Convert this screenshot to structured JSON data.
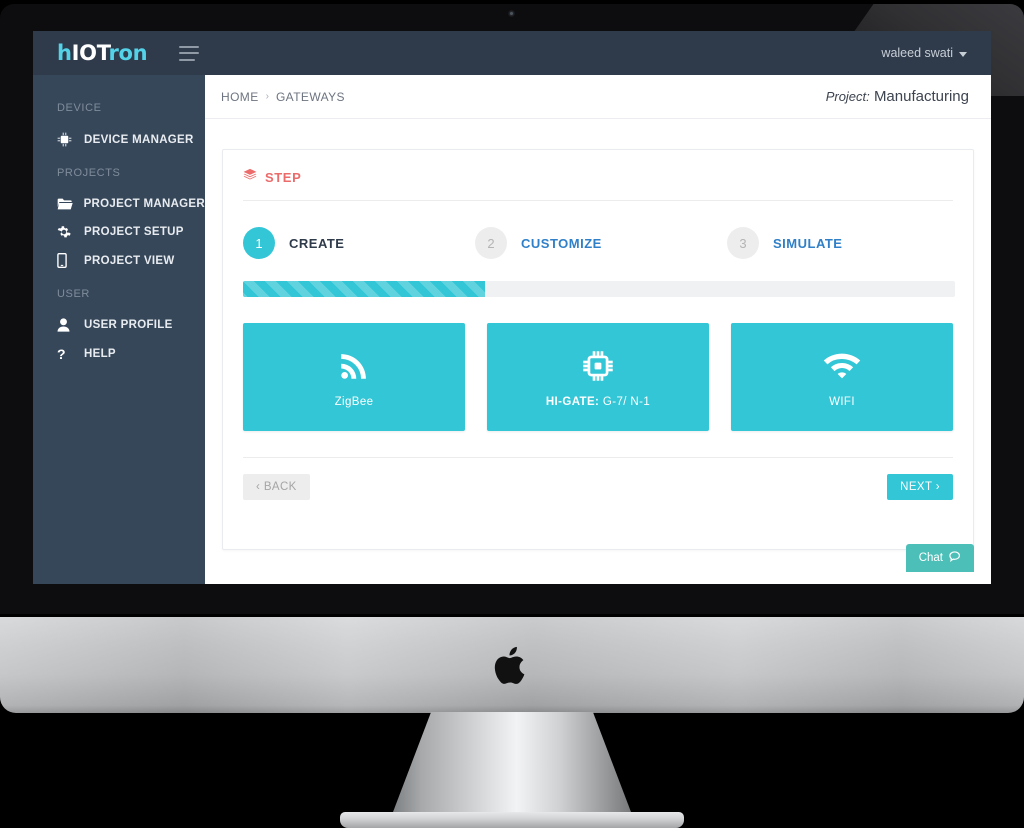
{
  "logo": {
    "part1": "h",
    "part2": "IOT",
    "part3": "ron"
  },
  "topbar": {
    "menu_icon": "hamburger-icon",
    "user_name": "waleed swati",
    "caret_icon": "chevron-down-icon"
  },
  "sidebar": {
    "groups": [
      {
        "title": "DEVICE",
        "items": [
          {
            "label": "DEVICE MANAGER",
            "icon": "chip-icon"
          }
        ]
      },
      {
        "title": "PROJECTS",
        "items": [
          {
            "label": "PROJECT MANAGER",
            "icon": "folder-icon"
          },
          {
            "label": "PROJECT SETUP",
            "icon": "gear-icon"
          },
          {
            "label": "PROJECT VIEW",
            "icon": "mobile-icon"
          }
        ]
      },
      {
        "title": "USER",
        "items": [
          {
            "label": "USER PROFILE",
            "icon": "user-icon"
          },
          {
            "label": "HELP",
            "icon": "question-mark-icon"
          }
        ]
      }
    ]
  },
  "breadcrumb": {
    "items": [
      "HOME",
      "GATEWAYS"
    ],
    "separator": "›"
  },
  "project": {
    "prefix": "Project:",
    "name": "Manufacturing"
  },
  "panel": {
    "title": "STEP",
    "title_icon": "layers-stack-icon",
    "steps": [
      {
        "number": "1",
        "label": "CREATE",
        "state": "active"
      },
      {
        "number": "2",
        "label": "CUSTOMIZE",
        "state": "idle"
      },
      {
        "number": "3",
        "label": "SIMULATE",
        "state": "idle"
      }
    ],
    "progress_percent": 34,
    "gateways": [
      {
        "label": "ZigBee",
        "label_bold": "",
        "icon": "rss-signal-icon"
      },
      {
        "label": " G-7/ N-1",
        "label_bold": "HI-GATE:",
        "icon": "microchip-icon"
      },
      {
        "label": "WIFI",
        "label_bold": "",
        "icon": "wifi-icon"
      }
    ],
    "back_button": "‹ BACK",
    "next_button": "NEXT ›"
  },
  "chat": {
    "label": "Chat",
    "icon": "speech-bubble-icon"
  },
  "colors": {
    "teal": "#33c6d6",
    "sidebar": "#37475a",
    "topbar": "#2f3b4b",
    "step_red": "#ec6b6b",
    "step_blue": "#2f80c8",
    "chat_green": "#4cbfb8"
  }
}
